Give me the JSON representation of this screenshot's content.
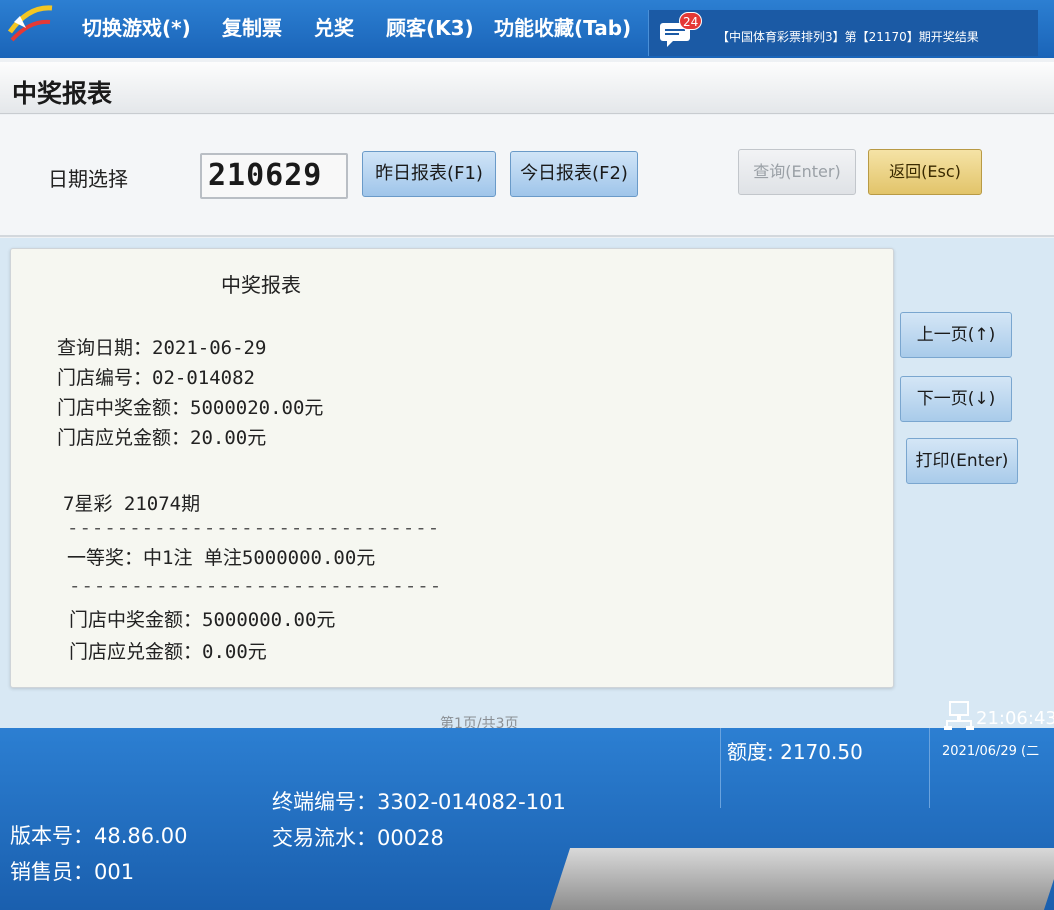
{
  "topbar": {
    "menu": [
      "切换游戏(*)",
      "复制票",
      "兑奖",
      "顾客(K3)",
      "功能收藏(Tab)"
    ],
    "badge_count": "24",
    "notice": "【中国体育彩票排列3】第【21170】期开奖结果"
  },
  "page": {
    "title": "中奖报表"
  },
  "date_row": {
    "label": "日期选择",
    "value": "210629",
    "btn_yesterday": "昨日报表(F1)",
    "btn_today": "今日报表(F2)",
    "btn_query": "查询(Enter)",
    "btn_back": "返回(Esc)"
  },
  "report": {
    "title": "中奖报表",
    "lines": [
      "查询日期：2021-06-29",
      "门店编号：02-014082",
      "门店中奖金额：5000020.00元",
      "门店应兑金额：20.00元",
      "7星彩 21074期",
      "------------------------------",
      "一等奖：中1注 单注5000000.00元",
      "------------------------------",
      "门店中奖金额：5000000.00元",
      "门店应兑金额：0.00元"
    ],
    "page_indicator": "第1页/共3页"
  },
  "side": {
    "prev": "上一页(↑)",
    "next": "下一页(↓)",
    "print": "打印(Enter)"
  },
  "status": {
    "credit": "额度: 2170.50",
    "time": "21:06:43",
    "date": "2021/06/29 (二",
    "version": "版本号：48.86.00",
    "seller": "销售员：001",
    "terminal": "终端编号：3302-014082-101",
    "transaction": "交易流水：00028"
  },
  "colors": {
    "topbar": "#1a64b8",
    "button_blue": "#9fc5ea",
    "button_back": "#e2c46a",
    "badge": "#e53935"
  }
}
